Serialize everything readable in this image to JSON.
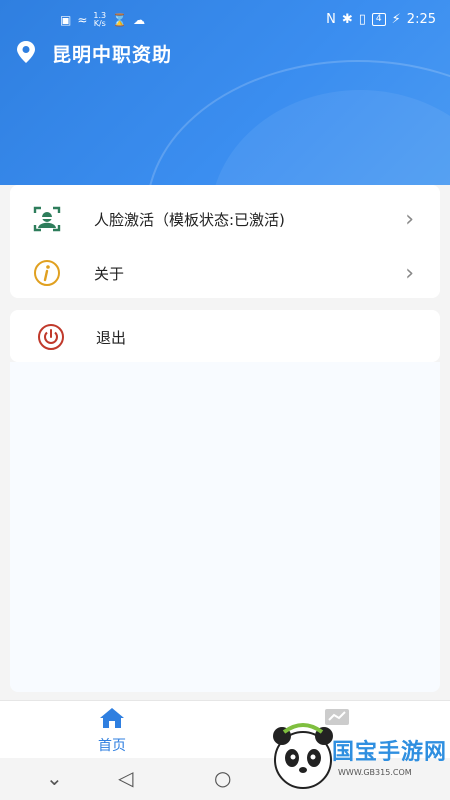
{
  "status_bar": {
    "network_speed_value": "1.3",
    "network_speed_unit": "K/s",
    "battery_level": "4",
    "time": "2:25"
  },
  "header": {
    "title": "昆明中职资助",
    "icon": "location-pin-icon",
    "color": "#2f7fe0"
  },
  "menu": {
    "items": [
      {
        "label": "人脸激活（模板状态:已激活)",
        "icon": "face-scan-icon",
        "color": "#2e7d5b"
      },
      {
        "label": "关于",
        "icon": "info-icon",
        "color": "#e0a020"
      }
    ],
    "logout": {
      "label": "退出",
      "icon": "power-icon",
      "color": "#c0392b"
    }
  },
  "tabbar": {
    "tabs": [
      {
        "label": "首页",
        "icon": "home-icon",
        "active": true
      },
      {
        "label": "",
        "icon": "chart-icon",
        "active": false
      }
    ]
  },
  "watermark": {
    "text": "国宝手游网",
    "url": "WWW.GB315.COM"
  }
}
